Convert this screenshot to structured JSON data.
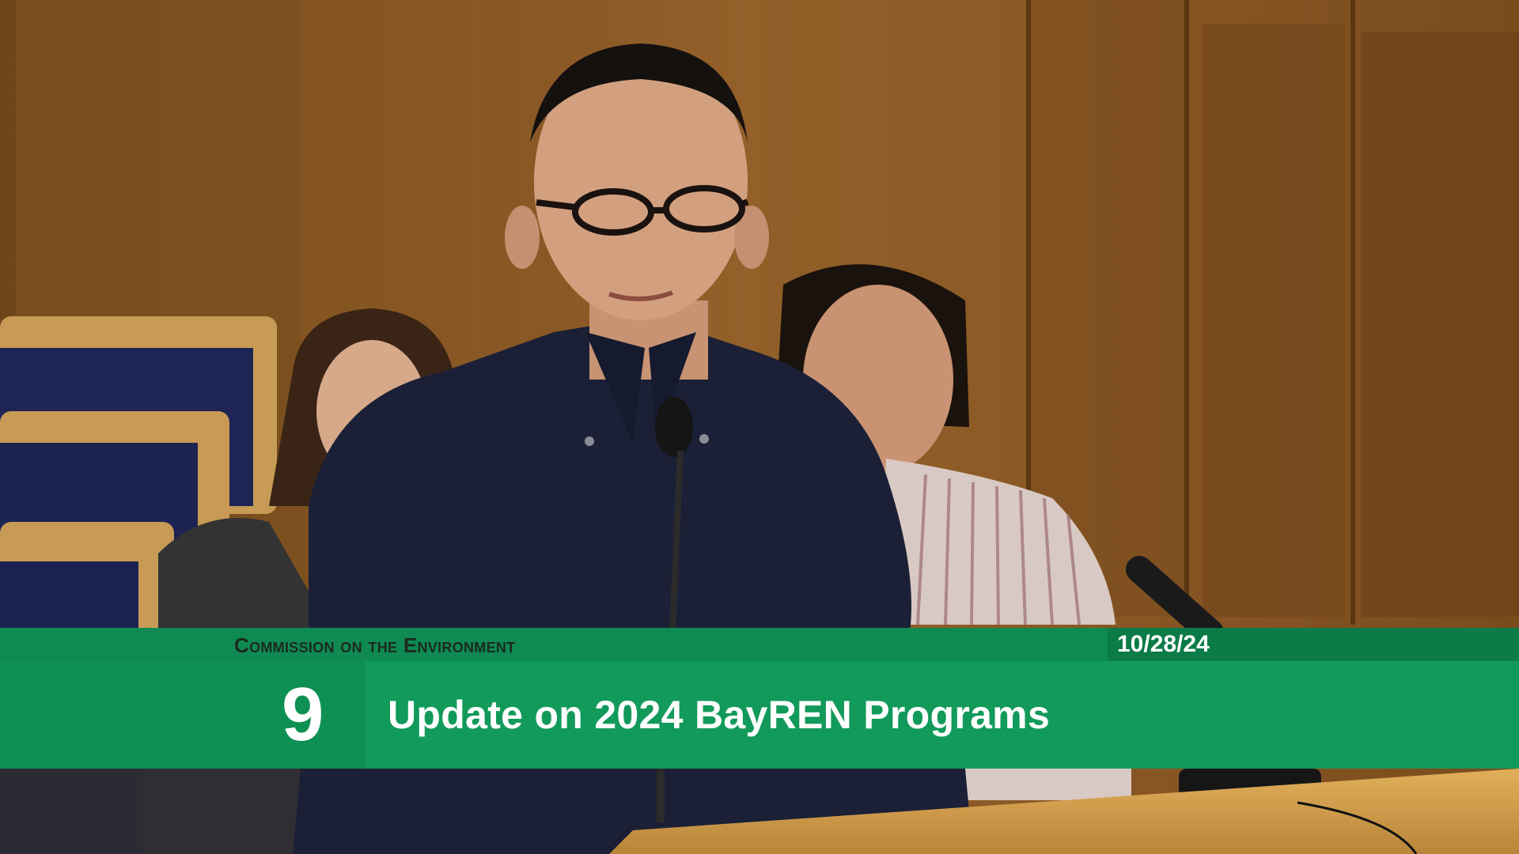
{
  "broadcast": {
    "commission": "Commission on the Environment",
    "date": "10/28/24",
    "item_number": "9",
    "item_title": "Update on 2024 BayREN Programs"
  },
  "colors": {
    "banner_green": "#129a5b",
    "banner_dark_green": "#0b7b47",
    "wood_panel": "#8a5a26",
    "text_white": "#ffffff"
  }
}
